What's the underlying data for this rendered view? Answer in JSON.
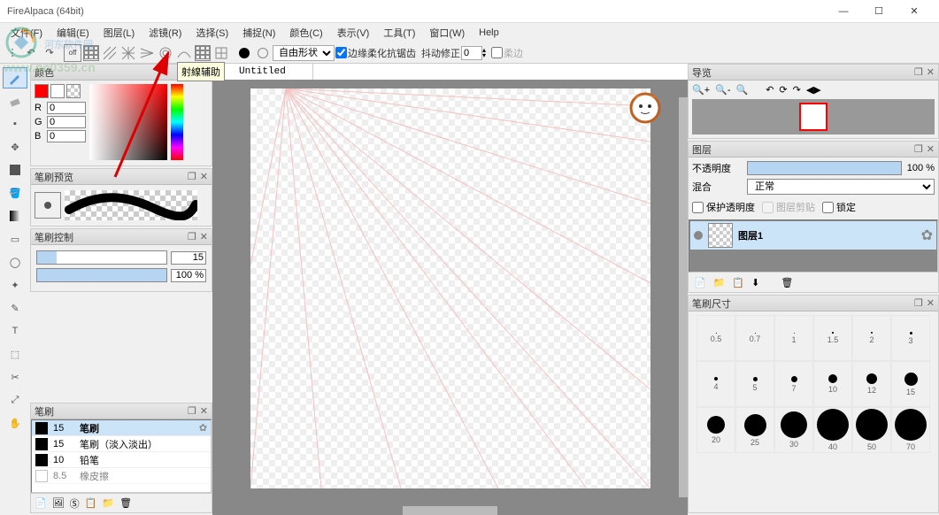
{
  "window": {
    "title": "FireAlpaca (64bit)"
  },
  "menu": {
    "items": [
      "文件(F)",
      "编辑(E)",
      "图层(L)",
      "滤镜(R)",
      "选择(S)",
      "捕捉(N)",
      "颜色(C)",
      "表示(V)",
      "工具(T)",
      "窗口(W)",
      "Help"
    ]
  },
  "toolbar": {
    "off_label": "off",
    "shape_dropdown": "自由形状",
    "antialias_label": "边缘柔化抗锯齿",
    "shake_label": "抖动修正",
    "shake_value": "0",
    "soft_label": "柔边",
    "tooltip": "射線辅助"
  },
  "tab": {
    "title": "Untitled"
  },
  "panels": {
    "color": {
      "title": "颜色",
      "r": "0",
      "g": "0",
      "b": "0"
    },
    "brush_preview": {
      "title": "笔刷预览"
    },
    "brush_control": {
      "title": "笔刷控制",
      "size_val": "15",
      "opacity_val": "100 %"
    },
    "brush_list": {
      "title": "笔刷",
      "items": [
        {
          "size": "15",
          "name": "笔刷",
          "selected": true
        },
        {
          "size": "15",
          "name": "笔刷（淡入淡出）"
        },
        {
          "size": "10",
          "name": "铅笔"
        },
        {
          "size": "8.5",
          "name": "橡皮擦"
        }
      ]
    },
    "navigator": {
      "title": "导览"
    },
    "layers": {
      "title": "图层",
      "opacity_label": "不透明度",
      "opacity_val": "100 %",
      "blend_label": "混合",
      "blend_value": "正常",
      "protect_label": "保护透明度",
      "clip_label": "图层剪贴",
      "lock_label": "锁定",
      "items": [
        {
          "name": "图层1"
        }
      ]
    },
    "brush_size": {
      "title": "笔刷尺寸",
      "sizes": [
        0.5,
        0.7,
        1,
        1.5,
        2,
        3,
        4,
        5,
        7,
        10,
        12,
        15,
        20,
        25,
        30,
        40,
        50,
        70
      ]
    }
  },
  "watermark": {
    "text": "河东软件园",
    "url": "www.pc0359.cn"
  }
}
